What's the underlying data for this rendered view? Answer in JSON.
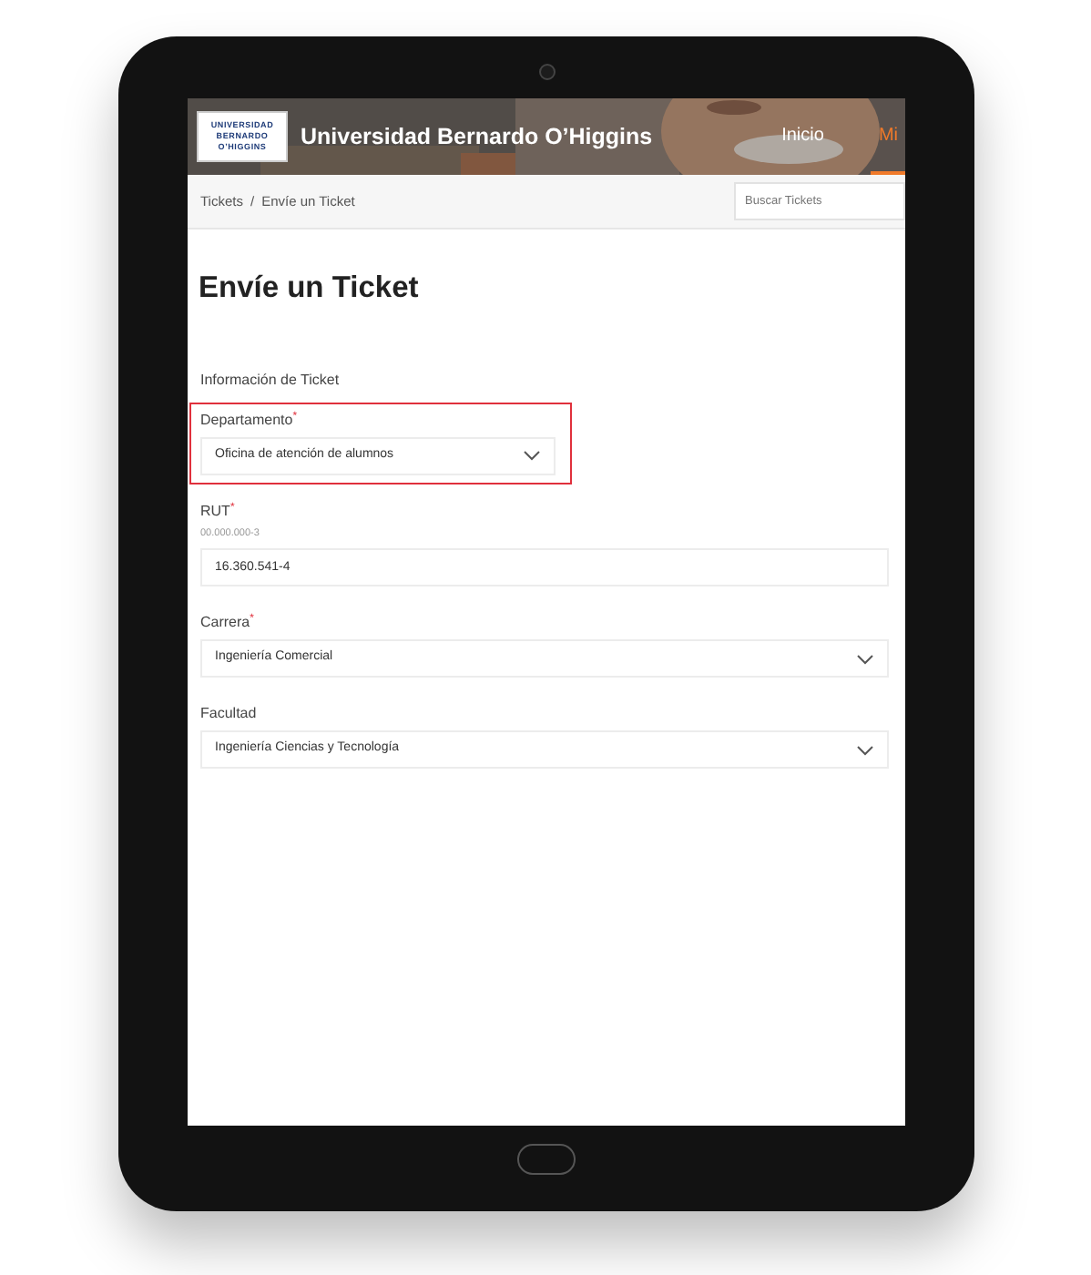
{
  "header": {
    "logo_lines": [
      "UNIVERSIDAD",
      "BERNARDO",
      "O’HIGGINS"
    ],
    "title": "Universidad Bernardo O’Higgins",
    "nav": [
      {
        "label": "Inicio",
        "selected": false
      },
      {
        "label": "Mi",
        "selected": true
      }
    ]
  },
  "breadcrumb": {
    "items": [
      "Tickets",
      "Envíe un Ticket"
    ],
    "separator": "/"
  },
  "search": {
    "placeholder": "Buscar Tickets"
  },
  "page_title": "Envíe un Ticket",
  "section": "Información de Ticket",
  "fields": [
    {
      "kind": "select",
      "label": "Departamento",
      "mark": "*",
      "value": "Oficina de atención de alumnos",
      "highlighted": true
    },
    {
      "kind": "text",
      "label": "RUT",
      "mark": "*",
      "hint": "00.000.000-3",
      "value": "16.360.541-4",
      "highlighted": false
    },
    {
      "kind": "select",
      "label": "Carrera",
      "mark": "*",
      "value": "Ingeniería Comercial",
      "highlighted": false
    },
    {
      "kind": "select",
      "label": "Facultad",
      "value": "Ingeniería Ciencias y Tecnología",
      "highlighted": false
    }
  ]
}
